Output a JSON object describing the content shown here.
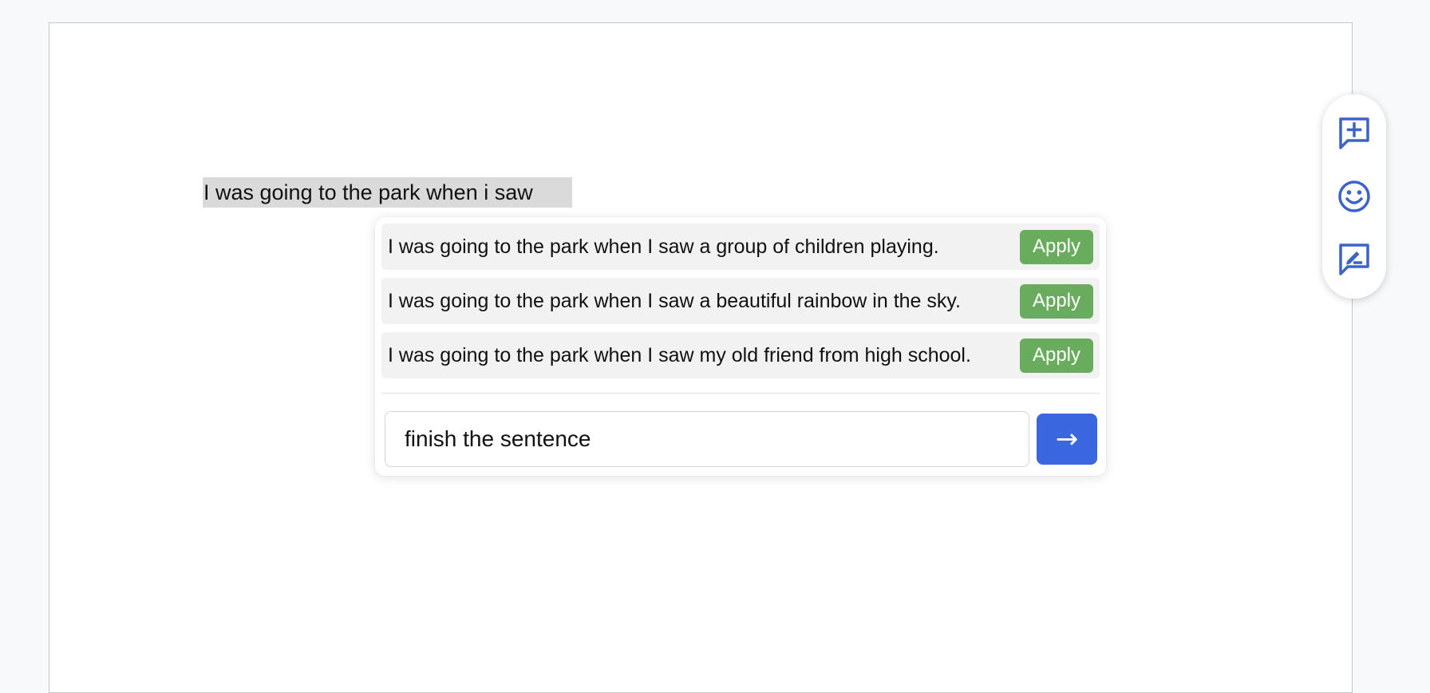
{
  "document": {
    "selected_text": "I was going to the park when i saw"
  },
  "suggestions": [
    {
      "text": "I was going to the park when I saw a group of children playing.",
      "apply_label": "Apply"
    },
    {
      "text": "I was going to the park when I saw a beautiful rainbow in the sky.",
      "apply_label": "Apply"
    },
    {
      "text": "I was going to the park when I saw my old friend from high school.",
      "apply_label": "Apply"
    }
  ],
  "prompt": {
    "value": "finish the sentence",
    "send_icon": "→"
  },
  "side_toolbar": {
    "tools": [
      "add-comment-icon",
      "emoji-icon",
      "suggest-edit-icon"
    ]
  },
  "colors": {
    "apply": "#6aac5e",
    "send": "#3a66e0",
    "toolbar_icon": "#3b63c9",
    "highlight": "#dadada"
  }
}
